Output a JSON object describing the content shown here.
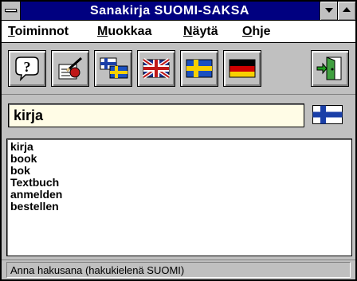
{
  "window": {
    "title": "Sanakirja  SUOMI-SAKSA"
  },
  "menu": [
    {
      "mnemonic": "T",
      "rest": "oiminnot"
    },
    {
      "mnemonic": "M",
      "rest": "uokkaa"
    },
    {
      "mnemonic": "N",
      "rest": "äytä"
    },
    {
      "mnemonic": "O",
      "rest": "hje"
    }
  ],
  "toolbar": {
    "buttons": [
      "help-icon",
      "edit-icon",
      "finnish-swedish-flags-icon",
      "english-flag-icon",
      "swedish-flag-icon",
      "german-flag-icon",
      "exit-door-icon"
    ]
  },
  "search": {
    "value": "kirja",
    "language_flag": "finnish-flag-icon"
  },
  "results": [
    "kirja",
    "book",
    "bok",
    "Textbuch",
    "anmelden",
    "bestellen"
  ],
  "status": {
    "text": "Anna hakusana (hakukielenä SUOMI)"
  },
  "colors": {
    "titlebar": "#000080",
    "face": "#c0c0c0",
    "input_bg": "#fffce6",
    "finnish_blue": "#1a3fa8"
  }
}
